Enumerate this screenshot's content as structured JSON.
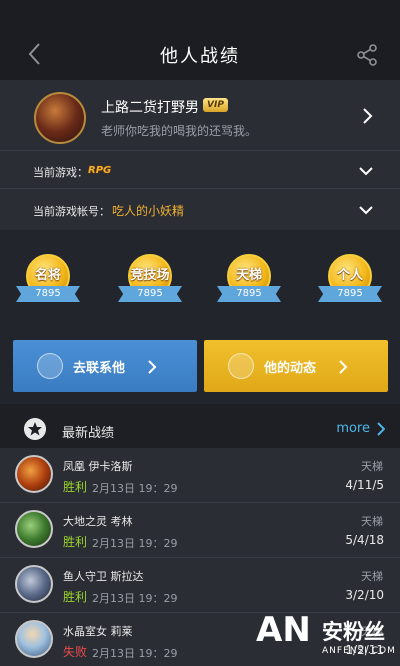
{
  "header": {
    "title": "他人战绩",
    "back_icon": "chevron-left-icon",
    "share_icon": "share-icon"
  },
  "profile": {
    "name": "上路二货打野男",
    "vip": "VIP",
    "signature": "老师你吃我的喝我的还骂我。",
    "current_game_label": "当前游戏：",
    "current_game_logo": "RPG",
    "current_account_label": "当前游戏帐号：",
    "current_account": "吃人的小妖精"
  },
  "badges": [
    {
      "title": "名将",
      "value": "7895"
    },
    {
      "title": "竞技场",
      "value": "7895"
    },
    {
      "title": "天梯",
      "value": "7895"
    },
    {
      "title": "个人",
      "value": "7895"
    }
  ],
  "actions": {
    "contact_label": "去联系他",
    "activity_label": "他的动态",
    "contact_color": "#4a90d6",
    "activity_color": "#f1c02c"
  },
  "recent": {
    "title": "最新战绩",
    "more": "more"
  },
  "matches": [
    {
      "hero": "凤凰 伊卡洛斯",
      "result": "胜利",
      "time": "2月13日 19：29",
      "mode": "天梯",
      "kda": "4/11/5",
      "win": true
    },
    {
      "hero": "大地之灵 考林",
      "result": "胜利",
      "time": "2月13日 19：29",
      "mode": "天梯",
      "kda": "5/4/18",
      "win": true
    },
    {
      "hero": "鱼人守卫 斯拉达",
      "result": "胜利",
      "time": "2月13日 19：29",
      "mode": "天梯",
      "kda": "3/2/10",
      "win": true
    },
    {
      "hero": "水晶室女 莉莱",
      "result": "失败",
      "time": "2月13日 19：29",
      "mode": "天梯",
      "kda": "1/2/11",
      "win": false
    }
  ],
  "watermark": {
    "brand": "AN",
    "cn": "安粉丝",
    "url": "ANFENSI.COM"
  },
  "colors": {
    "accent_gold": "#f0b030",
    "win_green": "#9ad32b",
    "lose_red": "#e84a4a",
    "link_blue": "#4fb6e8"
  }
}
